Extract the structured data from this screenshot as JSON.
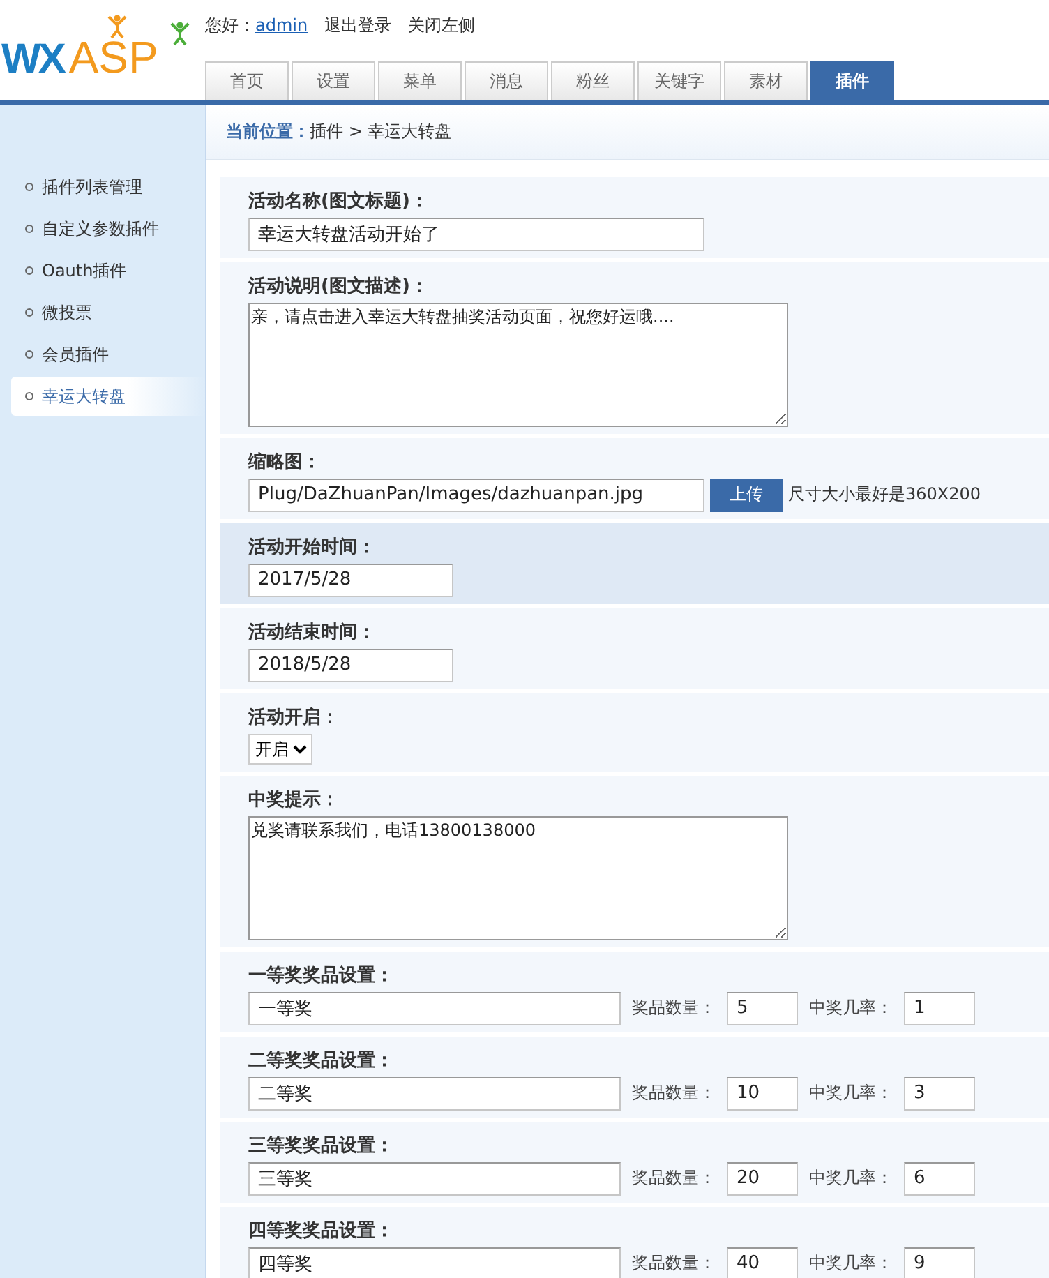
{
  "logo": {
    "part_1": "WX",
    "part_2": "ASP"
  },
  "topbar": {
    "greeting": "您好：",
    "user": "admin",
    "links": [
      "退出登录",
      "关闭左侧"
    ]
  },
  "tabs": [
    {
      "label": "首页",
      "selected": false
    },
    {
      "label": "设置",
      "selected": false
    },
    {
      "label": "菜单",
      "selected": false
    },
    {
      "label": "消息",
      "selected": false
    },
    {
      "label": "粉丝",
      "selected": false
    },
    {
      "label": "关键字",
      "selected": false
    },
    {
      "label": "素材",
      "selected": false
    },
    {
      "label": "插件",
      "selected": true
    }
  ],
  "sidebar": {
    "items": [
      {
        "label": "插件列表管理",
        "selected": false
      },
      {
        "label": "自定义参数插件",
        "selected": false
      },
      {
        "label": "Oauth插件",
        "selected": false
      },
      {
        "label": "微投票",
        "selected": false
      },
      {
        "label": "会员插件",
        "selected": false
      },
      {
        "label": "幸运大转盘",
        "selected": true
      }
    ]
  },
  "breadcrumb": {
    "label": "当前位置：",
    "path": "插件 > 幸运大转盘"
  },
  "form": [
    {
      "kind": "text",
      "label": "活动名称(图文标题)：",
      "value": "幸运大转盘活动开始了",
      "highlighted": false
    },
    {
      "kind": "textarea",
      "label": "活动说明(图文描述)：",
      "value": "亲，请点击进入幸运大转盘抽奖活动页面，祝您好运哦....",
      "highlighted": false
    },
    {
      "kind": "upload",
      "label": "缩略图：",
      "value": "Plug/DaZhuanPan/Images/dazhuanpan.jpg",
      "button": "上传",
      "hint": "尺寸大小最好是360X200",
      "highlighted": false
    },
    {
      "kind": "date",
      "label": "活动开始时间：",
      "value": "2017/5/28",
      "highlighted": true
    },
    {
      "kind": "date",
      "label": "活动结束时间：",
      "value": "2018/5/28",
      "highlighted": false
    },
    {
      "kind": "select",
      "label": "活动开启：",
      "value": "开启",
      "highlighted": false
    },
    {
      "kind": "textarea",
      "label": "中奖提示：",
      "value": "兑奖请联系我们，电话13800138000",
      "highlighted": false
    },
    {
      "kind": "prize",
      "label": "一等奖奖品设置：",
      "value": "一等奖",
      "count_label": "奖品数量：",
      "count": "5",
      "rate_label": "中奖几率：",
      "rate": "1",
      "highlighted": false
    },
    {
      "kind": "prize",
      "label": "二等奖奖品设置：",
      "value": "二等奖",
      "count_label": "奖品数量：",
      "count": "10",
      "rate_label": "中奖几率：",
      "rate": "3",
      "highlighted": false
    },
    {
      "kind": "prize",
      "label": "三等奖奖品设置：",
      "value": "三等奖",
      "count_label": "奖品数量：",
      "count": "20",
      "rate_label": "中奖几率：",
      "rate": "6",
      "highlighted": false
    },
    {
      "kind": "prize",
      "label": "四等奖奖品设置：",
      "value": "四等奖",
      "count_label": "奖品数量：",
      "count": "40",
      "rate_label": "中奖几率：",
      "rate": "9",
      "highlighted": false
    },
    {
      "kind": "blank"
    }
  ]
}
